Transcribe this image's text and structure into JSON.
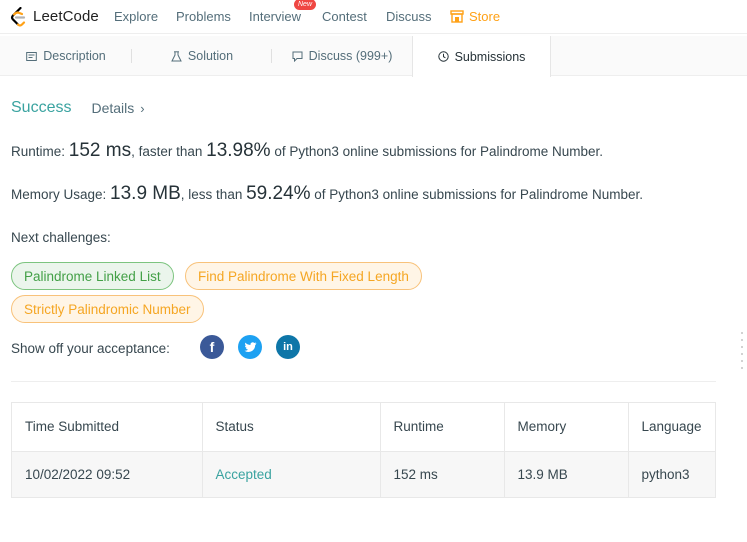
{
  "nav": {
    "logo_text": "LeetCode",
    "items": [
      "Explore",
      "Problems",
      "Interview",
      "Contest",
      "Discuss"
    ],
    "new_badge": "New",
    "store": "Store"
  },
  "tabs": {
    "description": "Description",
    "solution": "Solution",
    "discuss": "Discuss (999+)",
    "submissions": "Submissions"
  },
  "result": {
    "status": "Success",
    "details": "Details",
    "runtime_label": "Runtime: ",
    "runtime_value": "152 ms",
    "runtime_mid": ", faster than ",
    "runtime_pct": "13.98%",
    "runtime_tail": " of Python3 online submissions for Palindrome Number.",
    "memory_label": "Memory Usage: ",
    "memory_value": "13.9 MB",
    "memory_mid": ", less than ",
    "memory_pct": "59.24%",
    "memory_tail": " of Python3 online submissions for Palindrome Number."
  },
  "challenges": {
    "label": "Next challenges:",
    "items": [
      "Palindrome Linked List",
      "Find Palindrome With Fixed Length",
      "Strictly Palindromic Number"
    ]
  },
  "share": {
    "label": "Show off your acceptance:",
    "facebook": "f",
    "linkedin": "in"
  },
  "table": {
    "headers": [
      "Time Submitted",
      "Status",
      "Runtime",
      "Memory",
      "Language"
    ],
    "rows": [
      [
        "10/02/2022 09:52",
        "Accepted",
        "152 ms",
        "13.9 MB",
        "python3"
      ]
    ]
  },
  "colors": {
    "accent_teal": "#3aa3a0",
    "store_orange": "#ffa116",
    "chip_green": "#43a047",
    "chip_orange": "#f5a623"
  }
}
